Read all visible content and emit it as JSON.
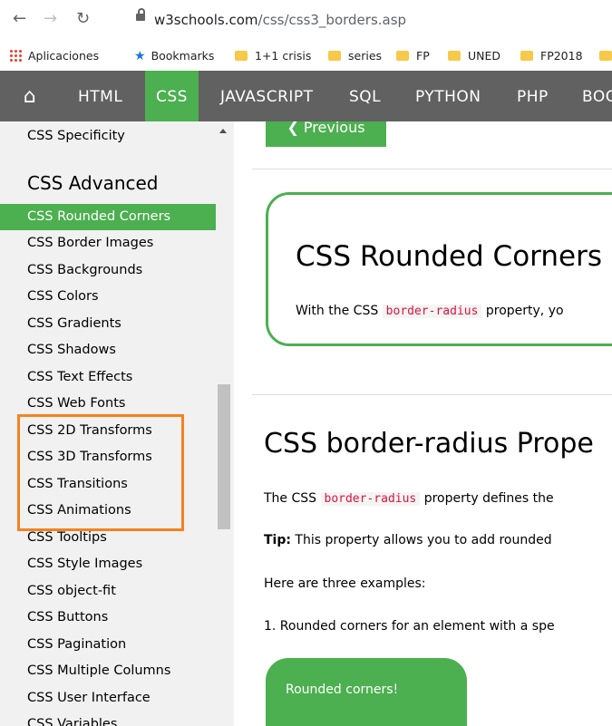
{
  "browser": {
    "url_main": "w3schools.com",
    "url_path": "/css/css3_borders.asp",
    "bookmarks": [
      "Aplicaciones",
      "Bookmarks",
      "1+1 crisis",
      "series",
      "FP",
      "UNED",
      "FP2018"
    ]
  },
  "topnav": {
    "items": [
      "HTML",
      "CSS",
      "JAVASCRIPT",
      "SQL",
      "PYTHON",
      "PHP",
      "BOO"
    ]
  },
  "sidebar": {
    "top_item": "CSS Specificity",
    "heading": "CSS Advanced",
    "items": [
      "CSS Rounded Corners",
      "CSS Border Images",
      "CSS Backgrounds",
      "CSS Colors",
      "CSS Gradients",
      "CSS Shadows",
      "CSS Text Effects",
      "CSS Web Fonts",
      "CSS 2D Transforms",
      "CSS 3D Transforms",
      "CSS Transitions",
      "CSS Animations",
      "CSS Tooltips",
      "CSS Style Images",
      "CSS object-fit",
      "CSS Buttons",
      "CSS Pagination",
      "CSS Multiple Columns",
      "CSS User Interface",
      "CSS Variables"
    ]
  },
  "main": {
    "prev_label": "❮ Previous",
    "title": "CSS Rounded Corners",
    "intro_before": "With the CSS ",
    "intro_code": "border-radius",
    "intro_after": " property, yo",
    "h2": "CSS border-radius Prope",
    "p1_before": "The CSS ",
    "p1_code": "border-radius",
    "p1_after": " property defines the",
    "tip_bold": "Tip:",
    "tip_rest": " This property allows you to add rounded",
    "p3": "Here are three examples:",
    "p4": "1. Rounded corners for an element with a spe",
    "rounded_label": "Rounded corners!"
  },
  "colors": {
    "accent": "#4caf50",
    "nav_bg": "#616161",
    "highlight": "#f5821f"
  }
}
